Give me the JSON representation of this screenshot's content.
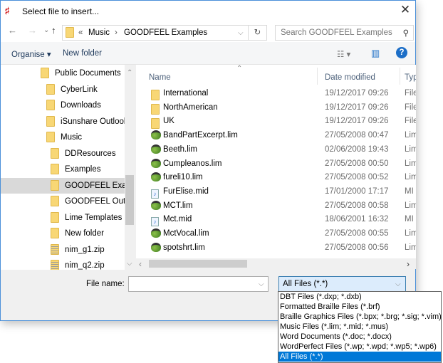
{
  "window": {
    "title": "Select file to insert...",
    "close_icon": "close-icon"
  },
  "nav": {
    "back": "←",
    "forward": "→",
    "recent": "⌄",
    "up": "↑",
    "breadcrumb_overflow": "«",
    "path": [
      "Music",
      "GOODFEEL Examples"
    ],
    "separator": "›",
    "search_placeholder": "Search GOODFEEL Examples"
  },
  "commands": {
    "organise": "Organise ▾",
    "new_folder": "New folder",
    "view": "☷ ▾",
    "preview": "▥",
    "help": "?"
  },
  "sidebar": {
    "items": [
      {
        "label": "Public Documents",
        "icon": "folder",
        "level": 0
      },
      {
        "label": "CyberLink",
        "icon": "folder",
        "level": 1
      },
      {
        "label": "Downloads",
        "icon": "folder",
        "level": 1
      },
      {
        "label": "iSunshare Outlook",
        "icon": "folder",
        "level": 1
      },
      {
        "label": "Music",
        "icon": "folder",
        "level": 1
      },
      {
        "label": "DDResources",
        "icon": "folder",
        "level": 2
      },
      {
        "label": "Examples",
        "icon": "folder",
        "level": 2
      },
      {
        "label": "GOODFEEL Examples",
        "icon": "folder",
        "level": 2,
        "selected": true
      },
      {
        "label": "GOODFEEL Output",
        "icon": "folder",
        "level": 2
      },
      {
        "label": "Lime Templates",
        "icon": "folder",
        "level": 2
      },
      {
        "label": "New folder",
        "icon": "folder",
        "level": 2
      },
      {
        "label": "nim_g1.zip",
        "icon": "zip",
        "level": 2
      },
      {
        "label": "nim_q2.zip",
        "icon": "zip",
        "level": 2
      }
    ]
  },
  "columns": {
    "name": "Name",
    "date": "Date modified",
    "type": "Typ"
  },
  "files": [
    {
      "name": "International",
      "date": "19/12/2017 09:26",
      "type": "File",
      "icon": "folder"
    },
    {
      "name": "NorthAmerican",
      "date": "19/12/2017 09:26",
      "type": "File",
      "icon": "folder"
    },
    {
      "name": "UK",
      "date": "19/12/2017 09:26",
      "type": "File",
      "icon": "folder"
    },
    {
      "name": "BandPartExcerpt.lim",
      "date": "27/05/2008 00:47",
      "type": "Lim",
      "icon": "lim"
    },
    {
      "name": "Beeth.lim",
      "date": "02/06/2008 19:43",
      "type": "Lim",
      "icon": "lim"
    },
    {
      "name": "Cumpleanos.lim",
      "date": "27/05/2008 00:50",
      "type": "Lim",
      "icon": "lim"
    },
    {
      "name": "fureli10.lim",
      "date": "27/05/2008 00:52",
      "type": "Lim",
      "icon": "lim"
    },
    {
      "name": "FurElise.mid",
      "date": "17/01/2000 17:17",
      "type": "MI",
      "icon": "mid"
    },
    {
      "name": "MCT.lim",
      "date": "27/05/2008 00:58",
      "type": "Lim",
      "icon": "lim"
    },
    {
      "name": "Mct.mid",
      "date": "18/06/2001 16:32",
      "type": "MI",
      "icon": "mid"
    },
    {
      "name": "MctVocal.lim",
      "date": "27/05/2008 00:55",
      "type": "Lim",
      "icon": "lim"
    },
    {
      "name": "spotshrt.lim",
      "date": "27/05/2008 00:56",
      "type": "Lim",
      "icon": "lim"
    }
  ],
  "filename": {
    "label": "File name:",
    "value": ""
  },
  "filter": {
    "selected": "All Files (*.*)",
    "options": [
      "DBT Files (*.dxp; *.dxb)",
      "Formatted Braille Files (*.brf)",
      "Braille Graphics Files (*.bpx; *.brg; *.sig; *.vim)",
      "Music Files (*.lim; *.mid; *.mus)",
      "Word Documents (*.doc; *.docx)",
      "WordPerfect Files (*.wp; *.wpd; *.wp5; *.wp6)",
      "All Files (*.*)"
    ]
  },
  "colors": {
    "accent": "#0078d7",
    "selected_row": "#d9d9d9",
    "help": "#1c6ec7"
  }
}
